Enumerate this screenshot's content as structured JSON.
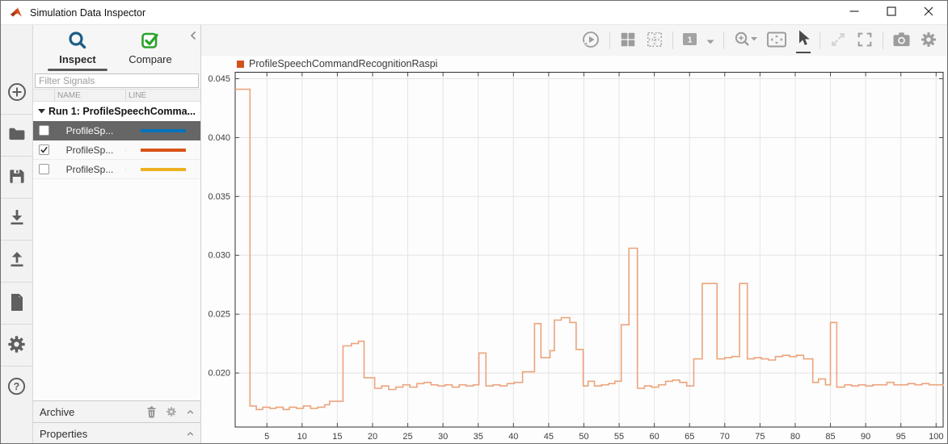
{
  "window": {
    "title": "Simulation Data Inspector",
    "controls": [
      {
        "name": "minimize-button",
        "icon": "minimize"
      },
      {
        "name": "maximize-button",
        "icon": "maximize"
      },
      {
        "name": "close-button",
        "icon": "close"
      }
    ]
  },
  "sidebar": {
    "items": [
      {
        "name": "new-run-button",
        "icon": "circle-plus"
      },
      {
        "name": "open-button",
        "icon": "folder"
      },
      {
        "name": "save-button",
        "icon": "floppy"
      },
      {
        "name": "import-button",
        "icon": "import"
      },
      {
        "name": "export-button",
        "icon": "export"
      },
      {
        "name": "report-button",
        "icon": "document"
      },
      {
        "name": "preferences-button",
        "icon": "gear"
      },
      {
        "name": "help-button",
        "icon": "help"
      }
    ]
  },
  "left_panel": {
    "tabs": [
      {
        "label": "Inspect",
        "icon": "search",
        "active": true
      },
      {
        "label": "Compare",
        "icon": "compare-check",
        "active": false
      }
    ],
    "filter": {
      "placeholder": "Filter Signals"
    },
    "table": {
      "columns": {
        "name": "NAME",
        "line": "LINE"
      },
      "group_label": "Run 1: ProfileSpeechComma...",
      "rows": [
        {
          "name": "ProfileSp...",
          "checked": false,
          "selected": true,
          "line_color": "#0072bd"
        },
        {
          "name": "ProfileSp...",
          "checked": true,
          "selected": false,
          "line_color": "#d95319"
        },
        {
          "name": "ProfileSp...",
          "checked": false,
          "selected": false,
          "line_color": "#edb120"
        }
      ]
    },
    "archive": {
      "label": "Archive"
    },
    "properties": {
      "label": "Properties"
    }
  },
  "toolbar": {
    "view_count": "1",
    "items": [
      {
        "name": "replay-button",
        "icon": "replay",
        "state": "normal"
      },
      {
        "name": "separator"
      },
      {
        "name": "subplot-layout-button",
        "icon": "grid",
        "state": "normal"
      },
      {
        "name": "edit-grid-button",
        "icon": "grid-dashed",
        "state": "normal"
      },
      {
        "name": "separator"
      },
      {
        "name": "view-layout-button",
        "icon": "one-view",
        "state": "normal"
      },
      {
        "name": "view-layout-dropdown",
        "icon": "caret-down",
        "state": "normal"
      },
      {
        "name": "separator"
      },
      {
        "name": "zoom-menu-button",
        "icon": "zoom",
        "state": "normal"
      },
      {
        "name": "fit-to-view-button",
        "icon": "fit",
        "state": "normal"
      },
      {
        "name": "pointer-tool-button",
        "icon": "pointer",
        "state": "selected"
      },
      {
        "name": "separator"
      },
      {
        "name": "expand-button",
        "icon": "expand",
        "state": "disabled"
      },
      {
        "name": "fullscreen-button",
        "icon": "fullscreen",
        "state": "normal"
      },
      {
        "name": "separator"
      },
      {
        "name": "snapshot-button",
        "icon": "camera",
        "state": "normal"
      },
      {
        "name": "settings-button",
        "icon": "gear-gray",
        "state": "normal"
      }
    ]
  },
  "chart_data": {
    "type": "line",
    "step": true,
    "grid": true,
    "legend_position": "top-left",
    "xlim": [
      0.5,
      101
    ],
    "ylim": [
      0.01541,
      0.04555
    ],
    "xticks": [
      5,
      10,
      15,
      20,
      25,
      30,
      35,
      40,
      45,
      50,
      55,
      60,
      65,
      70,
      75,
      80,
      85,
      90,
      95,
      100
    ],
    "yticks": [
      0.02,
      0.025,
      0.03,
      0.035,
      0.04,
      0.045
    ],
    "series": [
      {
        "name": "ProfileSpeechCommandRecognitionRaspi",
        "swatch": "#d2521e",
        "color": "#eca47c",
        "points": [
          [
            0.5,
            0.0441
          ],
          [
            2.6,
            0.0172
          ],
          [
            3.5,
            0.0169
          ],
          [
            4.4,
            0.0171
          ],
          [
            5.4,
            0.017
          ],
          [
            6.3,
            0.0171
          ],
          [
            7.3,
            0.0169
          ],
          [
            8.2,
            0.0171
          ],
          [
            9.2,
            0.017
          ],
          [
            10.2,
            0.0172
          ],
          [
            11.2,
            0.017
          ],
          [
            12.2,
            0.0171
          ],
          [
            13.2,
            0.0173
          ],
          [
            13.9,
            0.0176
          ],
          [
            15.8,
            0.0223
          ],
          [
            17.0,
            0.0225
          ],
          [
            18.0,
            0.0227
          ],
          [
            18.8,
            0.0196
          ],
          [
            20.3,
            0.0187
          ],
          [
            21.3,
            0.0189
          ],
          [
            22.3,
            0.0186
          ],
          [
            23.3,
            0.0188
          ],
          [
            24.3,
            0.019
          ],
          [
            25.3,
            0.0188
          ],
          [
            26.3,
            0.0191
          ],
          [
            27.3,
            0.0192
          ],
          [
            28.3,
            0.019
          ],
          [
            29.3,
            0.0189
          ],
          [
            30.3,
            0.019
          ],
          [
            31.3,
            0.0188
          ],
          [
            32.3,
            0.019
          ],
          [
            33.3,
            0.0189
          ],
          [
            34.3,
            0.019
          ],
          [
            35.1,
            0.0217
          ],
          [
            36.1,
            0.0189
          ],
          [
            37.1,
            0.019
          ],
          [
            38.1,
            0.0189
          ],
          [
            39.1,
            0.0191
          ],
          [
            40.1,
            0.0192
          ],
          [
            41.3,
            0.0201
          ],
          [
            43.0,
            0.0242
          ],
          [
            43.9,
            0.0213
          ],
          [
            45.2,
            0.0219
          ],
          [
            45.8,
            0.0245
          ],
          [
            46.8,
            0.0247
          ],
          [
            48.0,
            0.0243
          ],
          [
            48.9,
            0.022
          ],
          [
            49.9,
            0.0189
          ],
          [
            50.6,
            0.0193
          ],
          [
            51.5,
            0.0189
          ],
          [
            52.5,
            0.019
          ],
          [
            53.5,
            0.0191
          ],
          [
            54.4,
            0.0193
          ],
          [
            55.3,
            0.0241
          ],
          [
            56.4,
            0.0306
          ],
          [
            57.6,
            0.0187
          ],
          [
            58.6,
            0.0189
          ],
          [
            59.6,
            0.0188
          ],
          [
            60.6,
            0.019
          ],
          [
            61.6,
            0.0193
          ],
          [
            62.6,
            0.0194
          ],
          [
            63.6,
            0.0192
          ],
          [
            64.6,
            0.0189
          ],
          [
            65.6,
            0.0212
          ],
          [
            66.8,
            0.0276
          ],
          [
            68.9,
            0.0212
          ],
          [
            70.0,
            0.0213
          ],
          [
            71.0,
            0.0214
          ],
          [
            72.1,
            0.0276
          ],
          [
            73.2,
            0.0212
          ],
          [
            74.2,
            0.0213
          ],
          [
            75.2,
            0.0212
          ],
          [
            76.2,
            0.0211
          ],
          [
            77.2,
            0.0214
          ],
          [
            78.2,
            0.0215
          ],
          [
            79.2,
            0.0214
          ],
          [
            80.2,
            0.0215
          ],
          [
            81.2,
            0.0212
          ],
          [
            82.5,
            0.0192
          ],
          [
            83.3,
            0.0195
          ],
          [
            84.3,
            0.019
          ],
          [
            85.0,
            0.0243
          ],
          [
            85.9,
            0.0188
          ],
          [
            87.0,
            0.019
          ],
          [
            88.0,
            0.0189
          ],
          [
            89.0,
            0.019
          ],
          [
            90.0,
            0.0189
          ],
          [
            91.0,
            0.019
          ],
          [
            92.0,
            0.019
          ],
          [
            93.0,
            0.0192
          ],
          [
            94.0,
            0.019
          ],
          [
            95.0,
            0.019
          ],
          [
            96.0,
            0.0191
          ],
          [
            97.0,
            0.019
          ],
          [
            98.0,
            0.0191
          ],
          [
            99.0,
            0.019
          ],
          [
            101.0,
            0.0189
          ]
        ]
      }
    ]
  }
}
